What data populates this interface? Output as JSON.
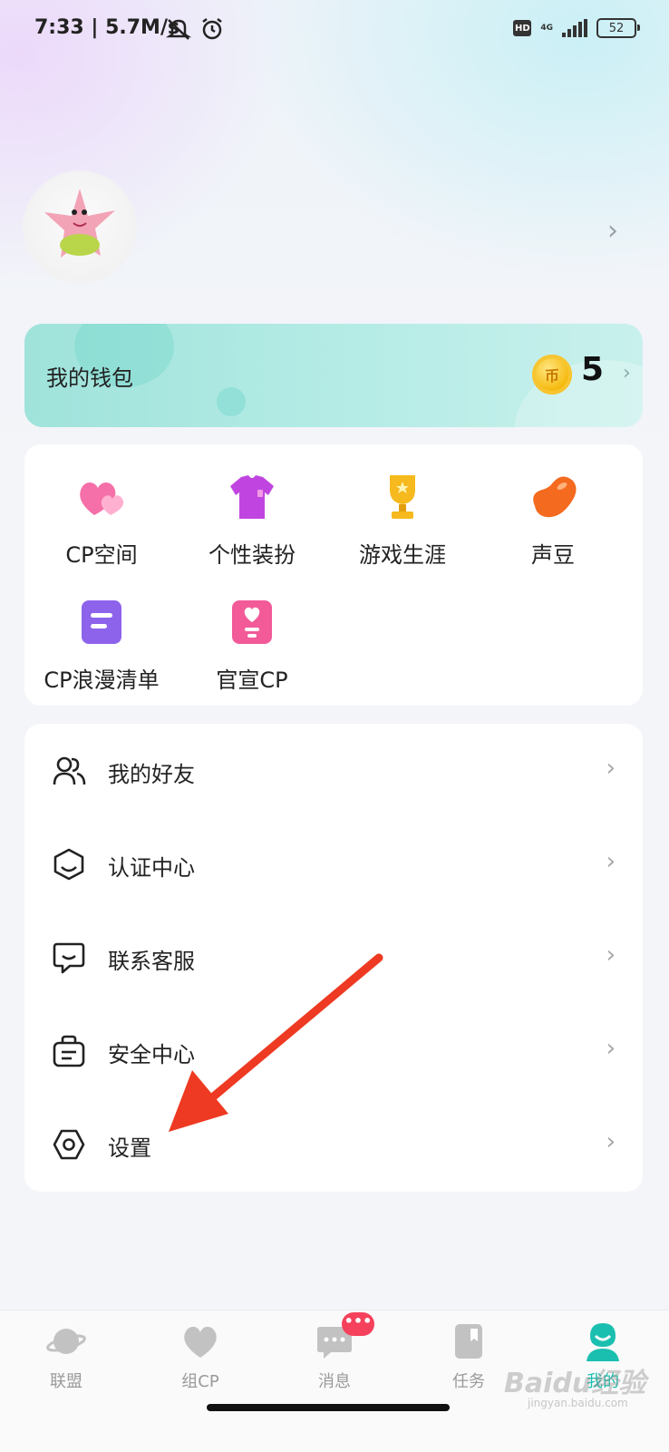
{
  "status_bar": {
    "time_speed": "7:33 | 5.7M/s",
    "hd": "HD",
    "network": "4G",
    "battery": "52"
  },
  "profile": {
    "avatar_icon": "patrick-star-avatar",
    "chevron": "›"
  },
  "wallet": {
    "title": "我的钱包",
    "coin_icon": "币",
    "amount": "5",
    "chevron": "›"
  },
  "features": [
    {
      "label": "CP空间",
      "icon": "hearts-icon"
    },
    {
      "label": "个性装扮",
      "icon": "tshirt-icon"
    },
    {
      "label": "游戏生涯",
      "icon": "trophy-icon"
    },
    {
      "label": "声豆",
      "icon": "bean-icon"
    },
    {
      "label": "CP浪漫清单",
      "icon": "list-icon"
    },
    {
      "label": "官宣CP",
      "icon": "heart-card-icon"
    }
  ],
  "menu": [
    {
      "label": "我的好友",
      "icon": "friends-icon"
    },
    {
      "label": "认证中心",
      "icon": "certification-icon"
    },
    {
      "label": "联系客服",
      "icon": "customer-service-icon"
    },
    {
      "label": "安全中心",
      "icon": "security-icon"
    },
    {
      "label": "设置",
      "icon": "settings-icon"
    }
  ],
  "menu_chevron": "›",
  "bottom_nav": [
    {
      "label": "联盟",
      "icon": "planet-icon"
    },
    {
      "label": "组CP",
      "icon": "heart-icon"
    },
    {
      "label": "消息",
      "icon": "message-icon",
      "badge": "•••"
    },
    {
      "label": "任务",
      "icon": "task-icon"
    },
    {
      "label": "我的",
      "icon": "profile-icon",
      "active": true
    }
  ],
  "watermark": {
    "text": "Baidu经验",
    "sub": "jingyan.baidu.com"
  },
  "colors": {
    "accent": "#1bbfb0",
    "wallet_bg": "#9fe3db",
    "badge": "#f5415b",
    "annotation_arrow": "#ee3a22"
  }
}
